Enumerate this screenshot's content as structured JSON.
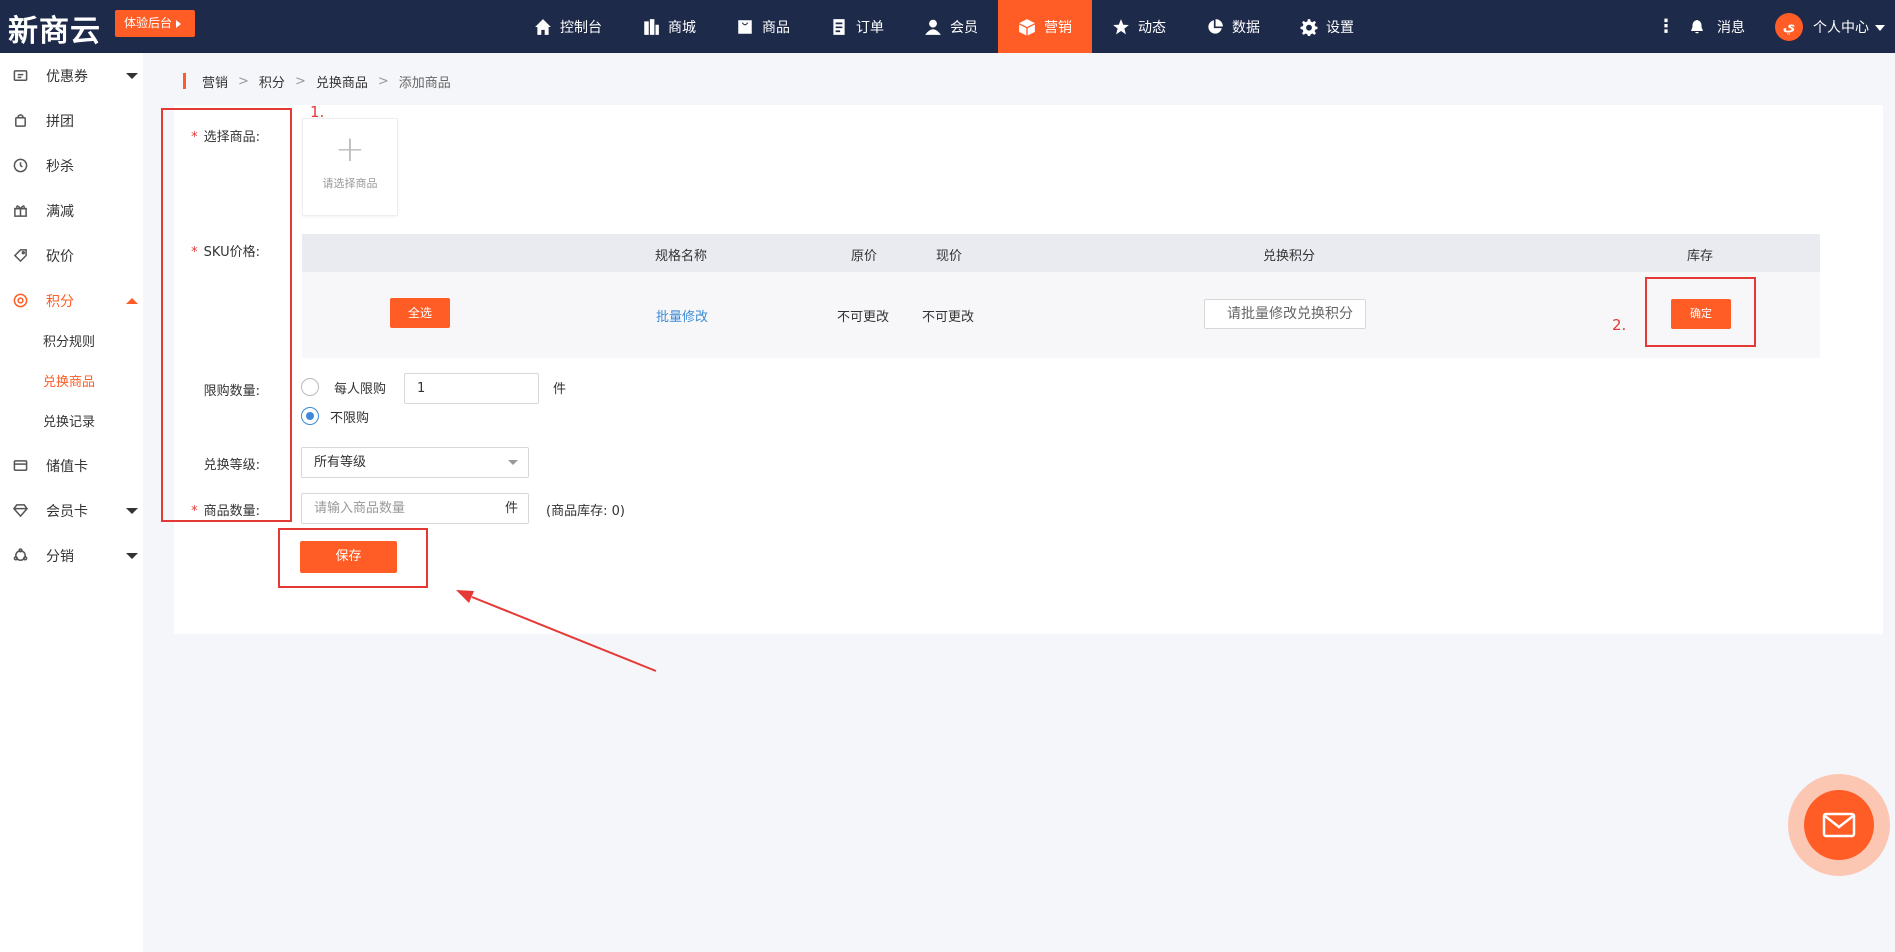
{
  "app": {
    "logo": "新商云",
    "trial_button": "体验后台"
  },
  "nav": [
    {
      "label": "控制台",
      "icon": "home-icon",
      "active": false
    },
    {
      "label": "商城",
      "icon": "store-icon",
      "active": false
    },
    {
      "label": "商品",
      "icon": "bag-icon",
      "active": false
    },
    {
      "label": "订单",
      "icon": "order-icon",
      "active": false
    },
    {
      "label": "会员",
      "icon": "user-icon",
      "active": false
    },
    {
      "label": "营销",
      "icon": "cube-icon",
      "active": true
    },
    {
      "label": "动态",
      "icon": "star-icon",
      "active": false
    },
    {
      "label": "数据",
      "icon": "pie-icon",
      "active": false
    },
    {
      "label": "设置",
      "icon": "gear-icon",
      "active": false
    }
  ],
  "topright": {
    "messages": "消息",
    "user_center": "个人中心"
  },
  "sidebar": {
    "items": [
      {
        "label": "优惠券",
        "icon": "coupon-icon"
      },
      {
        "label": "拼团",
        "icon": "group-buy-icon"
      },
      {
        "label": "秒杀",
        "icon": "flash-sale-icon"
      },
      {
        "label": "满减",
        "icon": "gift-icon"
      },
      {
        "label": "砍价",
        "icon": "bargain-icon"
      },
      {
        "label": "积分",
        "icon": "points-icon"
      },
      {
        "label": "储值卡",
        "icon": "card-icon"
      },
      {
        "label": "会员卡",
        "icon": "diamond-icon"
      },
      {
        "label": "分销",
        "icon": "distribution-icon"
      }
    ],
    "sub_items": [
      "积分规则",
      "兑换商品",
      "兑换记录"
    ]
  },
  "breadcrumb": [
    "营销",
    "积分",
    "兑换商品",
    "添加商品"
  ],
  "form": {
    "select_goods_label": "选择商品:",
    "select_goods_placeholder": "请选择商品",
    "sku_label": "SKU价格:",
    "sku_headers": [
      "规格名称",
      "原价",
      "现价",
      "兑换积分",
      "库存"
    ],
    "select_all": "全选",
    "batch_edit": "批量修改",
    "orig_price_value": "不可更改",
    "cur_price_value": "不可更改",
    "points_placeholder": "请批量修改兑换积分",
    "confirm": "确定",
    "limit_label": "限购数量:",
    "limit_per_person": "每人限购",
    "limit_value": "1",
    "limit_unit": "件",
    "no_limit": "不限购",
    "level_label": "兑换等级:",
    "level_value": "所有等级",
    "quantity_label": "商品数量:",
    "quantity_placeholder": "请输入商品数量",
    "quantity_unit": "件",
    "stock_note": "(商品库存: 0)",
    "save": "保存"
  },
  "annotations": {
    "mark1": "1.",
    "mark2": "2."
  },
  "colors": {
    "accent": "#ff5c26",
    "topbar": "#1e2a4a",
    "annotation": "#e53935",
    "link": "#3d8bd6"
  }
}
